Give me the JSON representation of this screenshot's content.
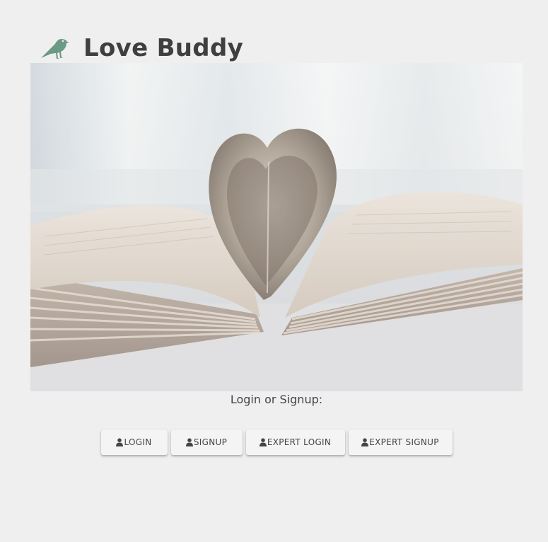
{
  "header": {
    "title": "Love Buddy",
    "logo_icon": "bird-icon",
    "logo_color": "#6b9a86"
  },
  "hero": {
    "image": "open-book-heart-pages-photo"
  },
  "auth": {
    "prompt": "Login or Signup:",
    "buttons": [
      {
        "label": "LOGIN",
        "icon": "user-icon"
      },
      {
        "label": "SIGNUP",
        "icon": "user-icon"
      },
      {
        "label": "EXPERT LOGIN",
        "icon": "user-icon"
      },
      {
        "label": "EXPERT SIGNUP",
        "icon": "user-icon"
      }
    ]
  }
}
